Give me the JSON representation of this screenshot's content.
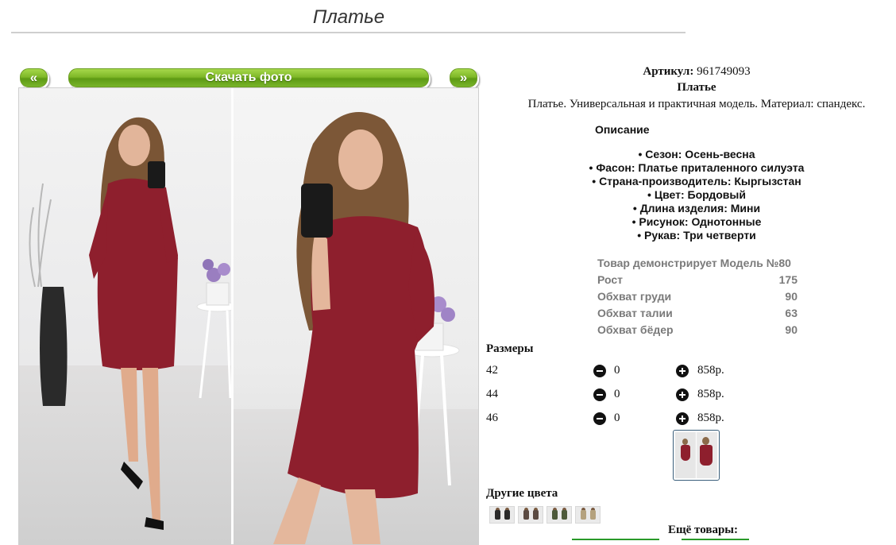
{
  "page": {
    "title": "Платье"
  },
  "gallery": {
    "prev_label": "«",
    "download_label": "Скачать фото",
    "next_label": "»"
  },
  "product": {
    "articul_label": "Артикул:",
    "articul_value": "961749093",
    "name": "Платье",
    "description": "Платье. Универсальная и практичная модель. Материал: спандекс."
  },
  "description": {
    "heading": "Описание",
    "features": [
      "Сезон: Осень-весна",
      "Фасон: Платье приталенного силуэта",
      "Страна-производитель: Кыргызстан",
      "Цвет: Бордовый",
      "Длина изделия: Мини",
      "Рисунок: Однотонные",
      "Рукав: Три четверти"
    ]
  },
  "model": {
    "heading": "Товар демонстрирует Модель №80",
    "rows": [
      {
        "label": "Рост",
        "value": "175"
      },
      {
        "label": "Обхват груди",
        "value": "90"
      },
      {
        "label": "Обхват талии",
        "value": "63"
      },
      {
        "label": "Обхват бёдер",
        "value": "90"
      }
    ]
  },
  "sizes": {
    "heading": "Размеры",
    "rows": [
      {
        "size": "42",
        "qty": "0",
        "price": "858р."
      },
      {
        "size": "44",
        "qty": "0",
        "price": "858р."
      },
      {
        "size": "46",
        "qty": "0",
        "price": "858р."
      }
    ]
  },
  "colors": {
    "heading": "Другие цвета",
    "count": 4
  },
  "more": {
    "heading": "Ещё товары:"
  },
  "theme": {
    "accent": "#7fb828",
    "dress": "#8e1f2d",
    "muted_text": "#7a7a7a"
  }
}
